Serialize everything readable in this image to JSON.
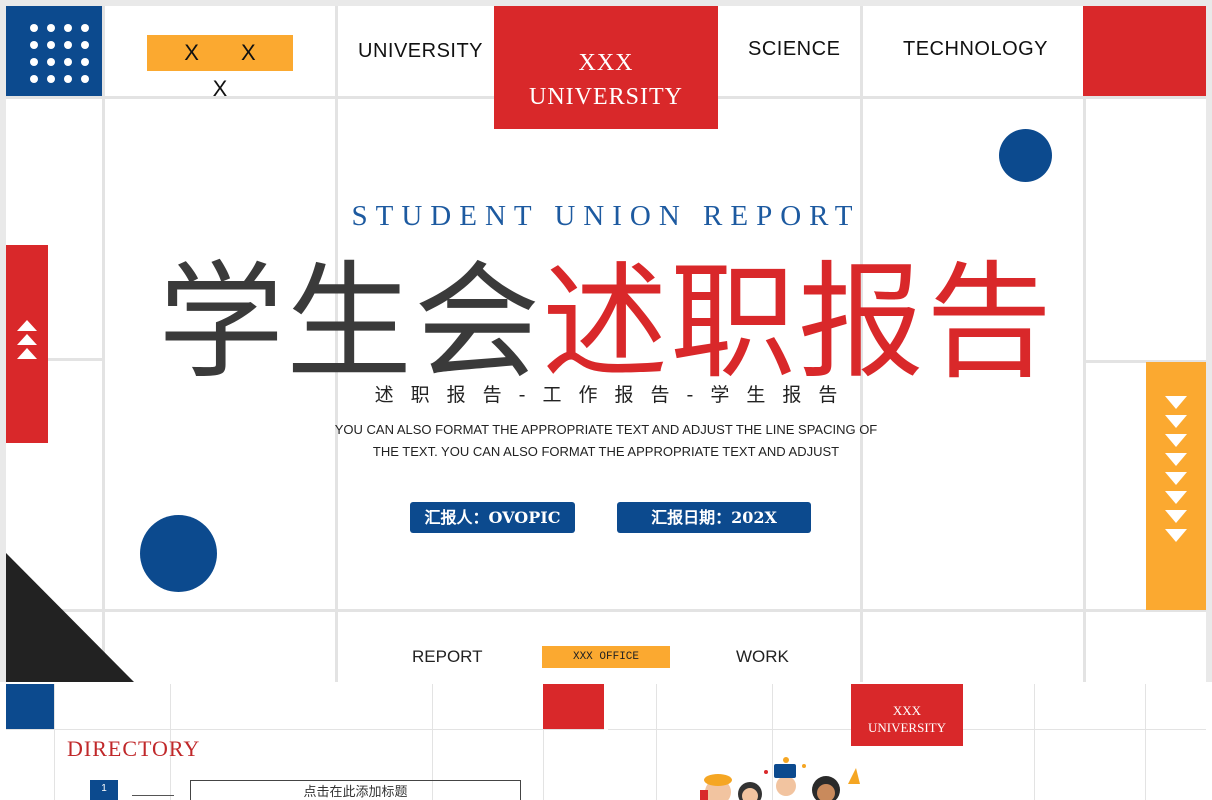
{
  "header": {
    "xxx_tag": "X X X",
    "university": "UNIVERSITY",
    "science": "SCIENCE",
    "technology": "TECHNOLOGY",
    "uni_block_line1": "XXX",
    "uni_block_line2": "UNIVERSITY"
  },
  "hero": {
    "subtitle_en": "STUDENT UNION REPORT",
    "title_part1": "学生会",
    "title_part2": "述职报告",
    "tagline": "述职报告-工作报告-学生报告",
    "description_line1": "YOU CAN ALSO FORMAT THE APPROPRIATE TEXT AND ADJUST THE LINE SPACING OF",
    "description_line2": "THE TEXT. YOU CAN ALSO FORMAT THE APPROPRIATE TEXT AND ADJUST",
    "reporter": "汇报人：OVOPIC",
    "report_date": "汇报日期：202X"
  },
  "footer": {
    "report": "REPORT",
    "office": "XXX OFFICE",
    "work": "WORK"
  },
  "thumbnails": {
    "directory": {
      "title": "DIRECTORY",
      "item_number": "1",
      "item_text": "点击在此添加标题"
    },
    "second": {
      "uni_line1": "XXX",
      "uni_line2": "UNIVERSITY"
    }
  },
  "colors": {
    "blue": "#0c4a8e",
    "red": "#d9282a",
    "orange": "#fba930",
    "dark": "#222222"
  }
}
